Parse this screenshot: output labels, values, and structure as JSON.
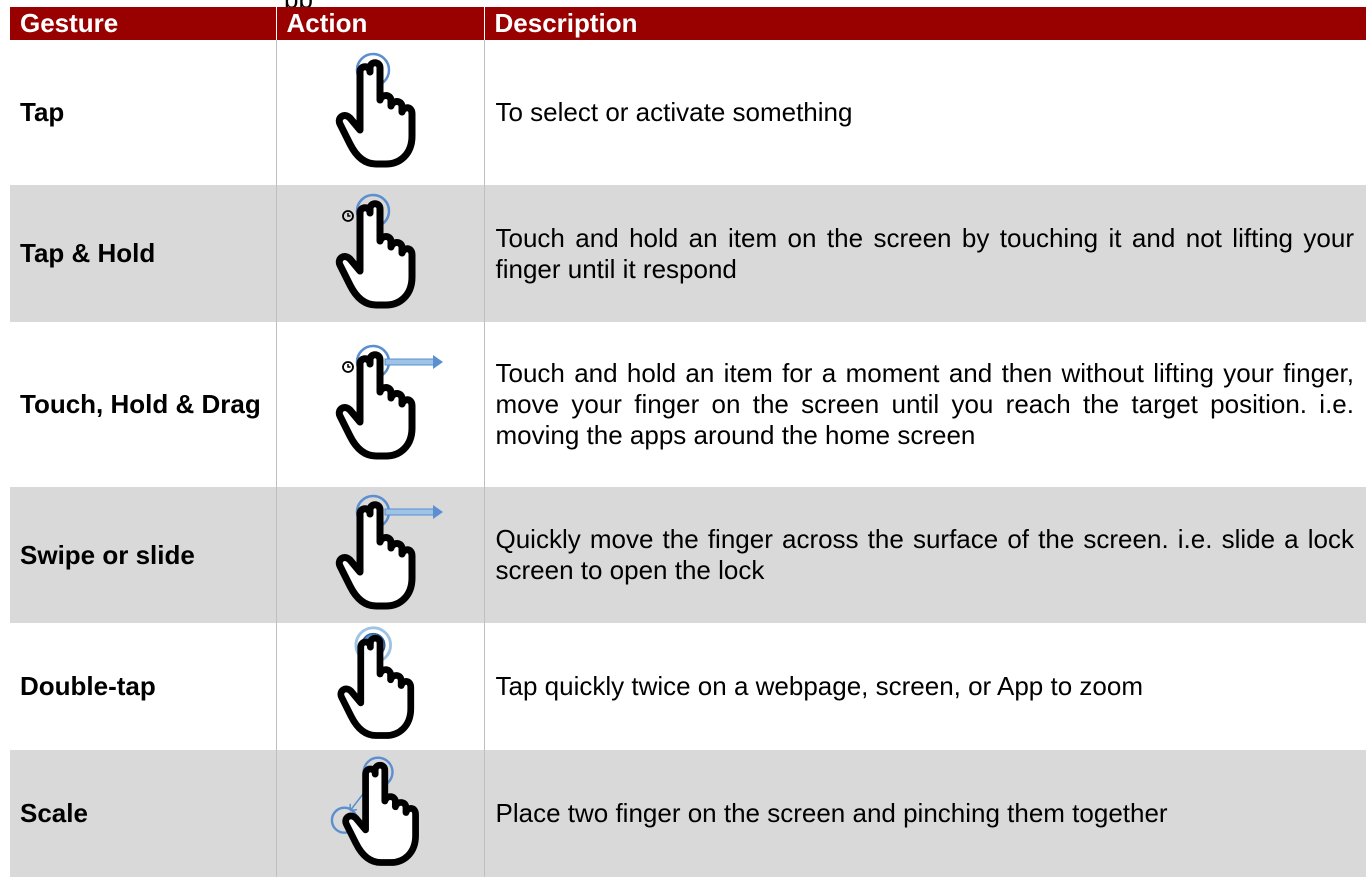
{
  "top_fragment": "pp",
  "table": {
    "headers": {
      "gesture": "Gesture",
      "action": "Action",
      "description": "Description"
    },
    "rows": [
      {
        "gesture": "Tap",
        "action_icon": "tap-gesture-icon",
        "description": "To select or activate something"
      },
      {
        "gesture": "Tap & Hold",
        "action_icon": "tap-hold-gesture-icon",
        "description": "Touch and hold an item on the screen by touching it and not lifting your finger until it respond"
      },
      {
        "gesture": "Touch, Hold & Drag",
        "action_icon": "touch-hold-drag-gesture-icon",
        "description": "Touch and hold an item for a moment and then without lifting your finger, move your finger on the screen until you reach the target position. i.e. moving the apps around the home screen"
      },
      {
        "gesture": "Swipe or slide",
        "action_icon": "swipe-gesture-icon",
        "description": "Quickly move the finger across the surface of the screen. i.e. slide a lock screen to open the lock"
      },
      {
        "gesture": "Double-tap",
        "action_icon": "double-tap-gesture-icon",
        "description": "Tap quickly twice on a webpage, screen, or App to zoom"
      },
      {
        "gesture": "Scale",
        "action_icon": "scale-gesture-icon",
        "description": "Place two finger on the screen and pinching them together"
      }
    ]
  },
  "colors": {
    "header_bg": "#990000",
    "header_text": "#ffffff",
    "row_alt_bg": "#d9d9d9",
    "touch_ring": "#5b8fd0"
  }
}
